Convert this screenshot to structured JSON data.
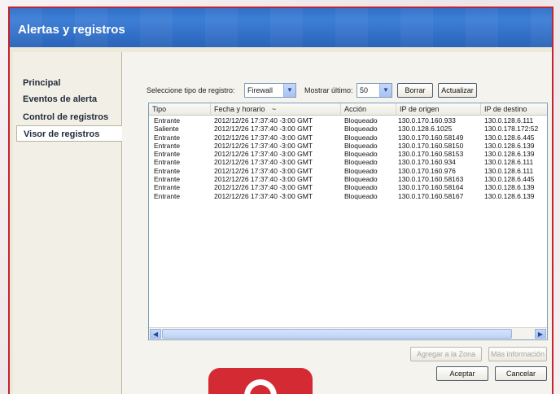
{
  "window": {
    "title": "Alertas y registros"
  },
  "sidebar": {
    "items": [
      {
        "label": "Principal"
      },
      {
        "label": "Eventos de alerta"
      },
      {
        "label": "Control de registros"
      },
      {
        "label": "Visor de registros",
        "active": true
      }
    ]
  },
  "toolbar": {
    "type_label": "Seleccione tipo de registro:",
    "type_value": "Firewall",
    "show_label": "Mostrar último:",
    "show_value": "50",
    "delete_label": "Borrar",
    "refresh_label": "Actualizar"
  },
  "table": {
    "columns": [
      "Tipo",
      "Fecha y horario",
      "Acción",
      "IP de origen",
      "IP de destino"
    ],
    "sort_indicator": "~",
    "rows": [
      [
        "Entrante",
        "2012/12/26 17:37:40 -3:00 GMT",
        "Bloqueado",
        "130.0.170.160.933",
        "130.0.128.6.111"
      ],
      [
        "Saliente",
        "2012/12/26 17:37:40 -3:00 GMT",
        "Bloqueado",
        "130.0.128.6.1025",
        "130.0.178.172:52"
      ],
      [
        "Entrante",
        "2012/12/26 17:37:40 -3:00 GMT",
        "Bloqueado",
        "130.0.170.160.58149",
        "130.0.128.6.445"
      ],
      [
        "Entrante",
        "2012/12/26 17:37:40 -3:00 GMT",
        "Bloqueado",
        "130.0.170.160.58150",
        "130.0.128.6.139"
      ],
      [
        "Entrante",
        "2012/12/26 17:37:40 -3:00 GMT",
        "Bloqueado",
        "130.0.170.160.58153",
        "130.0.128.6.139"
      ],
      [
        "Entrante",
        "2012/12/26 17:37:40 -3:00 GMT",
        "Bloqueado",
        "130.0.170.160.934",
        "130.0.128.6.111"
      ],
      [
        "Entrante",
        "2012/12/26 17:37:40 -3:00 GMT",
        "Bloqueado",
        "130.0.170.160.976",
        "130.0.128.6.111"
      ],
      [
        "Entrante",
        "2012/12/26 17:37:40 -3:00 GMT",
        "Bloqueado",
        "130.0.170.160.58163",
        "130.0.128.6.445"
      ],
      [
        "Entrante",
        "2012/12/26 17:37:40 -3:00 GMT",
        "Bloqueado",
        "130.0.170.160.58164",
        "130.0.128.6.139"
      ],
      [
        "Entrante",
        "2012/12/26 17:37:40 -3:00 GMT",
        "Bloqueado",
        "130.0.170.160.58167",
        "130.0.128.6.139"
      ]
    ]
  },
  "footer": {
    "add_zone_label": "Agregar a la Zona",
    "more_info_label": "Más información",
    "accept_label": "Aceptar",
    "cancel_label": "Cancelar"
  },
  "icons": {
    "dropdown": "chevron-down-icon",
    "scroll_left": "arrow-left-icon",
    "scroll_right": "arrow-right-icon"
  },
  "colors": {
    "titlebar": "#2f6fc8",
    "window_border": "#c4232b",
    "badge": "#d42a33"
  }
}
